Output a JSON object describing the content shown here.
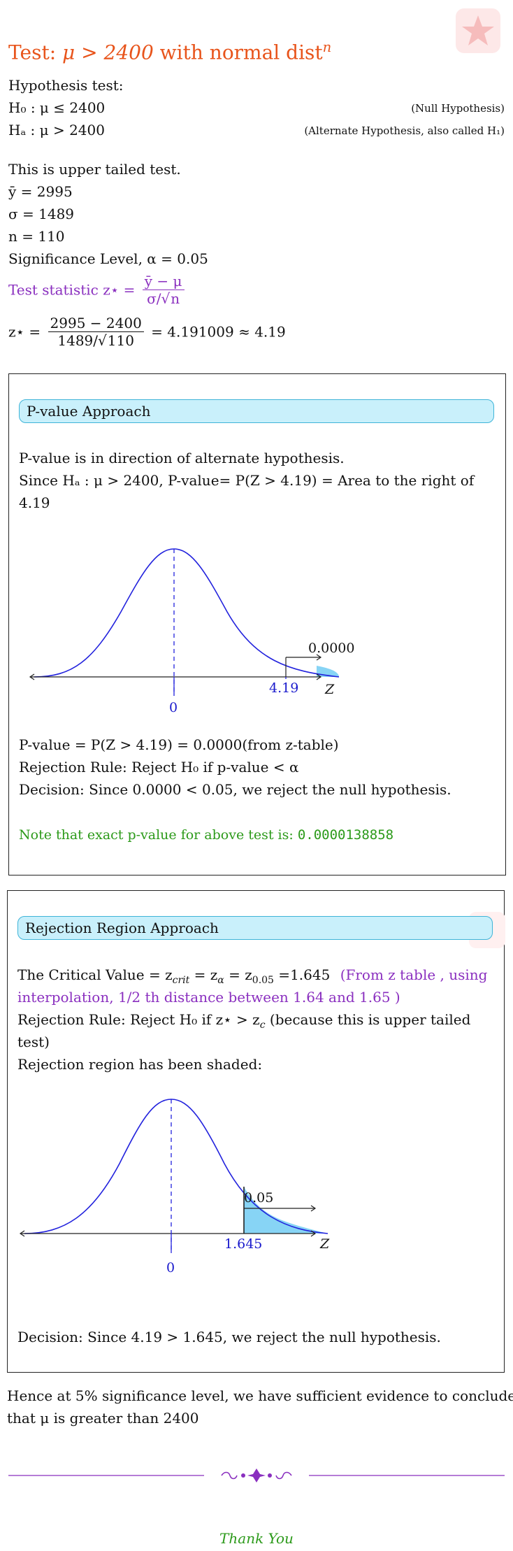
{
  "title": {
    "prefix": "Test:",
    "expr": "μ > 2400",
    "suffix": "with normal dist",
    "sup": "n"
  },
  "intro": {
    "heading": "Hypothesis test:",
    "h0": "H₀ : μ ≤ 2400",
    "h0_note": "(Null Hypothesis)",
    "ha": "Hₐ : μ > 2400",
    "ha_note": "(Alternate Hypothesis, also called H₁)",
    "tail": "This is upper tailed test.",
    "ybar": "ȳ = 2995",
    "sigma": "σ = 1489",
    "n": "n = 110",
    "alpha": "Significance Level, α = 0.05",
    "stat_label": "Test statistic z⋆ =",
    "stat_num": "ȳ − μ",
    "stat_den_a": "σ/",
    "stat_den_b": "n",
    "z_label": "z⋆ =",
    "z_num": "2995 − 2400",
    "z_den_a": "1489/",
    "z_den_b": "110",
    "z_result": "= 4.191009 ≈ 4.19"
  },
  "pvalue": {
    "banner": "P-value Approach",
    "line1": "P-value is in direction of alternate hypothesis.",
    "line2": "Since Hₐ : μ > 2400, P-value= P(Z > 4.19) = Area to the right of",
    "line3": "4.19",
    "chart": {
      "zero": "0",
      "tick": "4.19",
      "axis": "Z",
      "area": "0.0000"
    },
    "pv": "P-value = P(Z > 4.19) = 0.0000(from z-table)",
    "rule": "Rejection Rule: Reject H₀ if p-value < α",
    "decision": "Decision: Since 0.0000 < 0.05, we reject the null hypothesis.",
    "note": "Note that exact p-value for above test is:",
    "exact": "0.0000138858"
  },
  "rejection": {
    "banner": "Rejection Region Approach",
    "cv_a": "The Critical Value = z",
    "cv_b": "crit",
    "cv_c": " = z",
    "cv_d": "α",
    "cv_e": " = z",
    "cv_f": "0.05",
    "cv_g": " =1.645",
    "cv_note1": "(From z table , using",
    "cv_note2": "interpolation, 1/2 th distance between 1.64 and 1.65 )",
    "rule1": "Rejection Rule: Reject H₀ if z⋆ > z",
    "rule1_sub": "c",
    "rule1_tail": " (because this is upper tailed",
    "rule2": "test)",
    "shaded": "Rejection region has been shaded:",
    "chart": {
      "zero": "0",
      "tick": "1.645",
      "axis": "Z",
      "area": "0.05"
    },
    "decision": "Decision: Since 4.19 > 1.645, we reject the null hypothesis."
  },
  "conclusion": {
    "line1": "Hence at 5% significance level, we have sufficient evidence to conclude",
    "line2": "that μ is greater than 2400"
  },
  "footer": {
    "thanks": "Thank You"
  },
  "colors": {
    "orange": "#e8541b",
    "purple": "#8a2fbf",
    "green": "#2c9a1a",
    "curve": "#2222dd",
    "shade": "#87d4f5"
  }
}
